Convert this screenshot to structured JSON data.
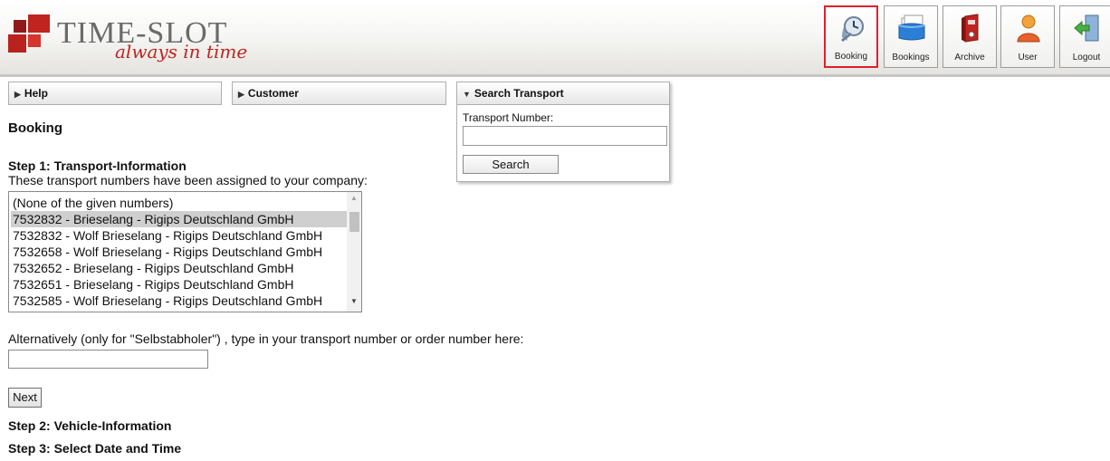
{
  "app": {
    "logo_text": "TIME-SLOT",
    "logo_tagline": "always in time"
  },
  "nav": {
    "active": "Booking",
    "buttons": [
      {
        "label": "Booking",
        "icon": "clock-timeslot-icon"
      },
      {
        "label": "Bookings",
        "icon": "stacked-documents-icon"
      },
      {
        "label": "Archive",
        "icon": "archive-binder-icon"
      },
      {
        "label": "User",
        "icon": "user-person-icon"
      },
      {
        "label": "Logout",
        "icon": "logout-door-icon"
      }
    ]
  },
  "panels": {
    "help": "Help",
    "customer": "Customer",
    "search_transport": {
      "title": "Search Transport",
      "field_label": "Transport Number:",
      "field_value": "",
      "button": "Search"
    }
  },
  "page": {
    "title": "Booking",
    "step1_title": "Step 1: Transport-Information",
    "step1_desc": "These transport numbers have been assigned to your company:",
    "transport_list": [
      "(None of the given numbers)",
      "7532832 - Brieselang - Rigips Deutschland GmbH",
      "7532832 - Wolf Brieselang - Rigips Deutschland GmbH",
      "7532658 - Wolf Brieselang - Rigips Deutschland GmbH",
      "7532652 - Brieselang - Rigips Deutschland GmbH",
      "7532651 - Brieselang - Rigips Deutschland GmbH",
      "7532585 - Wolf Brieselang - Rigips Deutschland GmbH"
    ],
    "selected_index": 1,
    "alt_text": "Alternatively (only for \"Selbstabholer\") , type in your transport number or order number here:",
    "alt_value": "",
    "next_button": "Next",
    "step2_title": "Step 2: Vehicle-Information",
    "step3_title": "Step 3: Select Date and Time"
  },
  "colors": {
    "brand_red": "#c0241f",
    "active_border": "#e0202a",
    "selected_row": "#cfcfcf"
  }
}
